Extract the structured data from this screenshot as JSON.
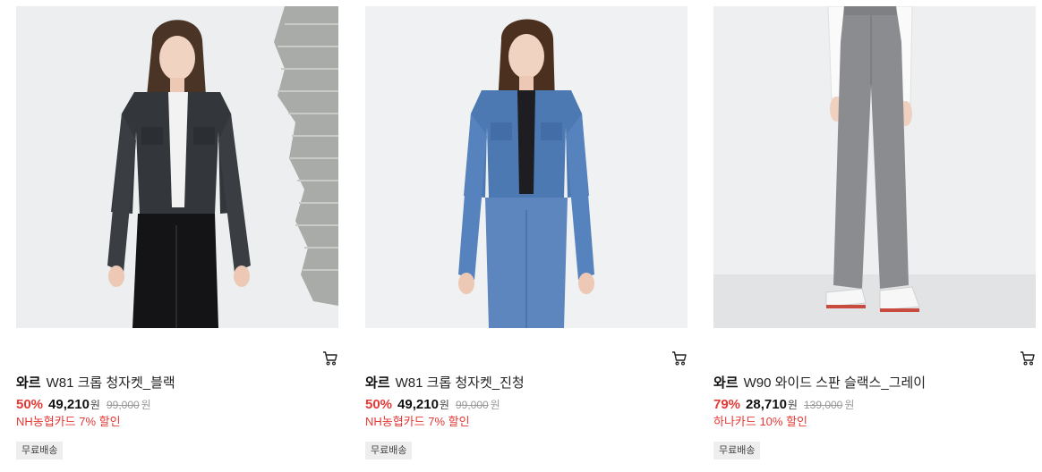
{
  "products": [
    {
      "brand": "와르",
      "name": "W81 크롭 청자켓_블랙",
      "discount_rate": "50%",
      "price": "49,210",
      "currency": "원",
      "original_price": "99,000",
      "original_currency": "원",
      "card_promo": "NH농협카드 7% 할인",
      "shipping_badge": "무료배송",
      "icon": "cart-icon"
    },
    {
      "brand": "와르",
      "name": "W81 크롭 청자켓_진청",
      "discount_rate": "50%",
      "price": "49,210",
      "currency": "원",
      "original_price": "99,000",
      "original_currency": "원",
      "card_promo": "NH농협카드 7% 할인",
      "shipping_badge": "무료배송",
      "icon": "cart-icon"
    },
    {
      "brand": "와르",
      "name": "W90 와이드 스판 슬랙스_그레이",
      "discount_rate": "79%",
      "price": "28,710",
      "currency": "원",
      "original_price": "139,000",
      "original_currency": "원",
      "card_promo": "하나카드 10% 할인",
      "shipping_badge": "무료배송",
      "icon": "cart-icon"
    }
  ],
  "colors": {
    "discount": "#e53935",
    "badge_bg": "#eeeeee",
    "photo_bg": "#e9eaec"
  }
}
